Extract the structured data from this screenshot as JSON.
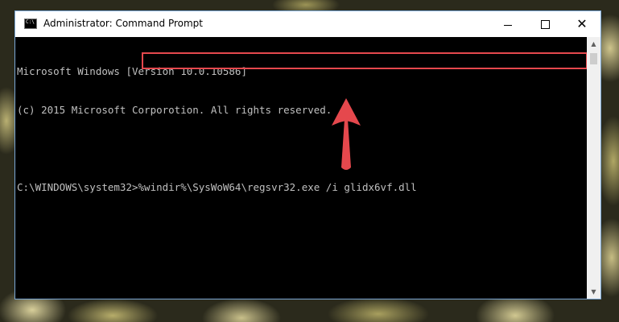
{
  "window": {
    "title": "Administrator: Command Prompt",
    "icon_text": "C:\\",
    "minimize_symbol": "",
    "maximize_symbol": "",
    "close_symbol": "✕"
  },
  "console": {
    "lines": [
      "Microsoft Windows [Version 10.0.10586]",
      "(c) 2015 Microsoft Corporotion. All rights reserved.",
      "",
      "C:\\WINDOWS\\system32>%windir%\\SysWoW64\\regsvr32.exe /i glidx6vf.dll"
    ]
  },
  "scrollbar": {
    "up_arrow": "▲",
    "down_arrow": "▼"
  },
  "annotation": {
    "highlight_color": "#e5484d",
    "arrow_color": "#e5484d",
    "arrow_icon": "up-arrow-icon"
  },
  "colors": {
    "console_bg": "#000000",
    "console_text": "#c0c0c0",
    "titlebar_bg": "#ffffff",
    "window_border": "#7aa7d6"
  }
}
